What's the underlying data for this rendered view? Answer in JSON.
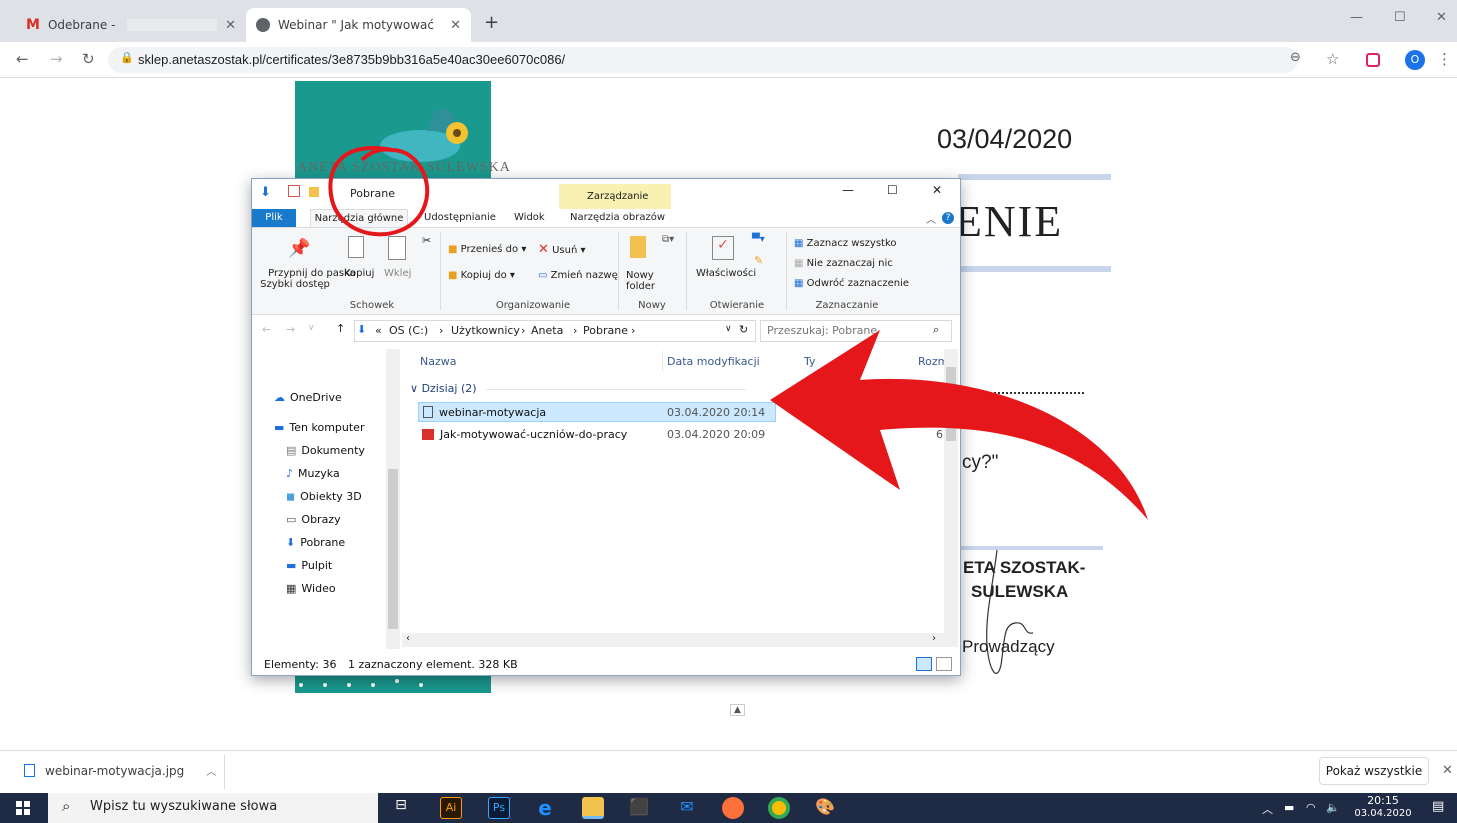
{
  "browser": {
    "tabs": [
      {
        "label": "Odebrane -",
        "favicon": "gmail-icon"
      },
      {
        "label": "Webinar \" Jak motywować uczni",
        "favicon": "globe-icon"
      }
    ],
    "new_tab_symbol": "+",
    "url": "sklep.anetaszostak.pl/certificates/3e8735b9bb316a5e40ac30ee6070c086/",
    "profile_initial": "O"
  },
  "certificate": {
    "date": "03/04/2020",
    "title_visible": "ENIE",
    "logo_text": "ANETA SZOSTAK-SULEWSKA",
    "quote_visible": "cy?\"",
    "name_line1": "ETA SZOSTAK-",
    "name_line2": "SULEWSKA",
    "role": "Prowadzący",
    "brand_color": "#1a9a8f"
  },
  "explorer": {
    "title": "Pobrane",
    "context_tab": "Zarządzanie",
    "tabs": [
      "Plik",
      "Narzędzia główne",
      "Udostępnianie",
      "Widok",
      "Narzędzia obrazów"
    ],
    "ribbon": {
      "pin": [
        "Przypnij do paska",
        "Szybki dostęp"
      ],
      "copy": "Kopiuj",
      "paste": "Wklej",
      "move_to": "Przenieś do",
      "copy_to": "Kopiuj do",
      "delete": "Usuń",
      "rename": "Zmień nazwę",
      "new_folder": [
        "Nowy",
        "folder"
      ],
      "properties": "Właściwości",
      "select_all": "Zaznacz wszystko",
      "select_none": "Nie zaznaczaj nic",
      "invert_selection": "Odwróć zaznaczenie",
      "groups": [
        "Schowek",
        "Organizowanie",
        "Nowy",
        "Otwieranie",
        "Zaznaczanie"
      ]
    },
    "breadcrumb": [
      "OS (C:)",
      "Użytkownicy",
      "Aneta",
      "Pobrane"
    ],
    "breadcrumb_prefix": "«",
    "search_placeholder": "Przeszukaj: Pobrane",
    "nav_items": [
      {
        "label": "OneDrive",
        "icon": "cloud-icon"
      },
      {
        "label": "Ten komputer",
        "icon": "computer-icon"
      },
      {
        "label": "Dokumenty",
        "icon": "document-icon"
      },
      {
        "label": "Muzyka",
        "icon": "music-icon"
      },
      {
        "label": "Obiekty 3D",
        "icon": "cube-icon"
      },
      {
        "label": "Obrazy",
        "icon": "pictures-icon"
      },
      {
        "label": "Pobrane",
        "icon": "download-icon"
      },
      {
        "label": "Pulpit",
        "icon": "desktop-icon"
      },
      {
        "label": "Wideo",
        "icon": "video-icon"
      }
    ],
    "columns": [
      "Nazwa",
      "Data modyfikacji",
      "Ty",
      "Rozm"
    ],
    "group_header": "Dzisiaj (2)",
    "files": [
      {
        "name": "webinar-motywacja",
        "date": "03.04.2020 20:14",
        "selected": true,
        "icon": "image-file-icon"
      },
      {
        "name": "Jak-motywować-uczniów-do-pracy",
        "date": "03.04.2020 20:09",
        "size_partial": "6",
        "selected": false,
        "icon": "pdf-file-icon"
      }
    ],
    "status_count": "Elementy: 36",
    "status_selection": "1 zaznaczony element. 328 KB"
  },
  "downloads": {
    "file": "webinar-motywacja.jpg",
    "show_all": "Pokaż wszystkie"
  },
  "taskbar": {
    "search_placeholder": "Wpisz tu wyszukiwane słowa",
    "time": "20:15",
    "date": "03.04.2020"
  }
}
